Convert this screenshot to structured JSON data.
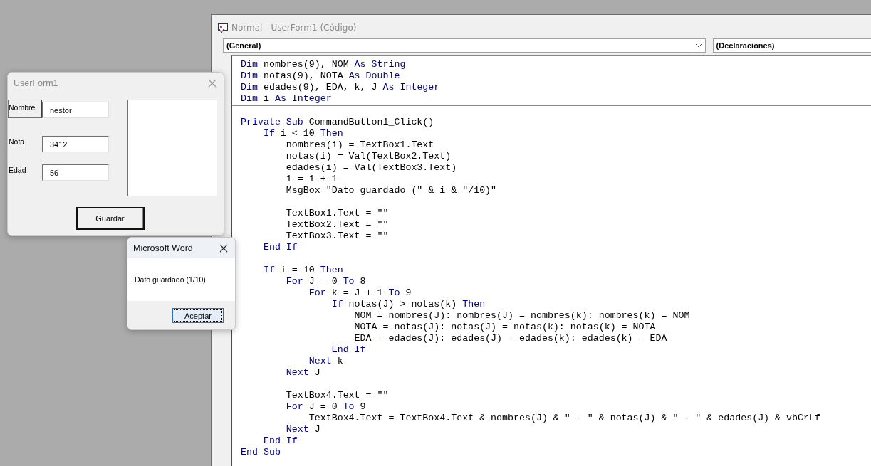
{
  "code_window": {
    "title": "Normal - UserForm1 (Código)",
    "object_dropdown": "(General)",
    "procedure_dropdown": "(Declaraciones)",
    "declarations": [
      {
        "kind": "code",
        "tokens": [
          {
            "text": "Dim",
            "kind": "keyword"
          },
          {
            "text": " nombres(9), NOM ",
            "kind": "plain"
          },
          {
            "text": "As String",
            "kind": "keyword"
          }
        ]
      },
      {
        "kind": "code",
        "tokens": [
          {
            "text": "Dim",
            "kind": "keyword"
          },
          {
            "text": " notas(9), NOTA ",
            "kind": "plain"
          },
          {
            "text": "As Double",
            "kind": "keyword"
          }
        ]
      },
      {
        "kind": "code",
        "tokens": [
          {
            "text": "Dim",
            "kind": "keyword"
          },
          {
            "text": " edades(9), EDA, k, J ",
            "kind": "plain"
          },
          {
            "text": "As Integer",
            "kind": "keyword"
          }
        ]
      },
      {
        "kind": "code",
        "tokens": [
          {
            "text": "Dim",
            "kind": "keyword"
          },
          {
            "text": " i ",
            "kind": "plain"
          },
          {
            "text": "As Integer",
            "kind": "keyword"
          }
        ]
      }
    ],
    "procedure": [
      {
        "kind": "code",
        "tokens": [
          {
            "text": "Private Sub",
            "kind": "keyword"
          },
          {
            "text": " CommandButton1_Click()",
            "kind": "plain"
          }
        ]
      },
      {
        "kind": "code",
        "tokens": [
          {
            "text": "    If",
            "kind": "keyword"
          },
          {
            "text": " i < 10 ",
            "kind": "plain"
          },
          {
            "text": "Then",
            "kind": "keyword"
          }
        ]
      },
      {
        "kind": "code",
        "tokens": [
          {
            "text": "        nombres(i) = TextBox1.Text",
            "kind": "plain"
          }
        ]
      },
      {
        "kind": "code",
        "tokens": [
          {
            "text": "        notas(i) = Val(TextBox2.Text)",
            "kind": "plain"
          }
        ]
      },
      {
        "kind": "code",
        "tokens": [
          {
            "text": "        edades(i) = Val(TextBox3.Text)",
            "kind": "plain"
          }
        ]
      },
      {
        "kind": "code",
        "tokens": [
          {
            "text": "        i = i + 1",
            "kind": "plain"
          }
        ]
      },
      {
        "kind": "code",
        "tokens": [
          {
            "text": "        MsgBox \"Dato guardado (\" & i & \"/10)\"",
            "kind": "plain"
          }
        ]
      },
      {
        "kind": "blank"
      },
      {
        "kind": "code",
        "tokens": [
          {
            "text": "        TextBox1.Text = \"\"",
            "kind": "plain"
          }
        ]
      },
      {
        "kind": "code",
        "tokens": [
          {
            "text": "        TextBox2.Text = \"\"",
            "kind": "plain"
          }
        ]
      },
      {
        "kind": "code",
        "tokens": [
          {
            "text": "        TextBox3.Text = \"\"",
            "kind": "plain"
          }
        ]
      },
      {
        "kind": "code",
        "tokens": [
          {
            "text": "    End If",
            "kind": "keyword"
          }
        ]
      },
      {
        "kind": "blank"
      },
      {
        "kind": "code",
        "tokens": [
          {
            "text": "    If",
            "kind": "keyword"
          },
          {
            "text": " i = 10 ",
            "kind": "plain"
          },
          {
            "text": "Then",
            "kind": "keyword"
          }
        ]
      },
      {
        "kind": "code",
        "tokens": [
          {
            "text": "        For",
            "kind": "keyword"
          },
          {
            "text": " J = 0 ",
            "kind": "plain"
          },
          {
            "text": "To",
            "kind": "keyword"
          },
          {
            "text": " 8",
            "kind": "plain"
          }
        ]
      },
      {
        "kind": "code",
        "tokens": [
          {
            "text": "            For",
            "kind": "keyword"
          },
          {
            "text": " k = J + 1 ",
            "kind": "plain"
          },
          {
            "text": "To",
            "kind": "keyword"
          },
          {
            "text": " 9",
            "kind": "plain"
          }
        ]
      },
      {
        "kind": "code",
        "tokens": [
          {
            "text": "                If",
            "kind": "keyword"
          },
          {
            "text": " notas(J) > notas(k) ",
            "kind": "plain"
          },
          {
            "text": "Then",
            "kind": "keyword"
          }
        ]
      },
      {
        "kind": "code",
        "tokens": [
          {
            "text": "                    NOM = nombres(J): nombres(J) = nombres(k): nombres(k) = NOM",
            "kind": "plain"
          }
        ]
      },
      {
        "kind": "code",
        "tokens": [
          {
            "text": "                    NOTA = notas(J): notas(J) = notas(k): notas(k) = NOTA",
            "kind": "plain"
          }
        ]
      },
      {
        "kind": "code",
        "tokens": [
          {
            "text": "                    EDA = edades(J): edades(J) = edades(k): edades(k) = EDA",
            "kind": "plain"
          }
        ]
      },
      {
        "kind": "code",
        "tokens": [
          {
            "text": "                End If",
            "kind": "keyword"
          }
        ]
      },
      {
        "kind": "code",
        "tokens": [
          {
            "text": "            Next",
            "kind": "keyword"
          },
          {
            "text": " k",
            "kind": "plain"
          }
        ]
      },
      {
        "kind": "code",
        "tokens": [
          {
            "text": "        Next",
            "kind": "keyword"
          },
          {
            "text": " J",
            "kind": "plain"
          }
        ]
      },
      {
        "kind": "blank"
      },
      {
        "kind": "code",
        "tokens": [
          {
            "text": "        TextBox4.Text = \"\"",
            "kind": "plain"
          }
        ]
      },
      {
        "kind": "code",
        "tokens": [
          {
            "text": "        For",
            "kind": "keyword"
          },
          {
            "text": " J = 0 ",
            "kind": "plain"
          },
          {
            "text": "To",
            "kind": "keyword"
          },
          {
            "text": " 9",
            "kind": "plain"
          }
        ]
      },
      {
        "kind": "code",
        "tokens": [
          {
            "text": "            TextBox4.Text = TextBox4.Text & nombres(J) & \" - \" & notas(J) & \" - \" & edades(J) & vbCrLf",
            "kind": "plain"
          }
        ]
      },
      {
        "kind": "code",
        "tokens": [
          {
            "text": "        Next",
            "kind": "keyword"
          },
          {
            "text": " J",
            "kind": "plain"
          }
        ]
      },
      {
        "kind": "code",
        "tokens": [
          {
            "text": "    End If",
            "kind": "keyword"
          }
        ]
      },
      {
        "kind": "code",
        "tokens": [
          {
            "text": "End Sub",
            "kind": "keyword"
          }
        ]
      }
    ]
  },
  "userform": {
    "title": "UserForm1",
    "fields": [
      {
        "label": "Nombre",
        "framed": true,
        "value": "nestor"
      },
      {
        "label": "Nota",
        "framed": false,
        "value": "3412"
      },
      {
        "label": "Edad",
        "framed": false,
        "value": "56"
      }
    ],
    "button": "Guardar"
  },
  "message_box": {
    "title": "Microsoft Word",
    "message": "Dato guardado (1/10)",
    "button": "Aceptar"
  }
}
